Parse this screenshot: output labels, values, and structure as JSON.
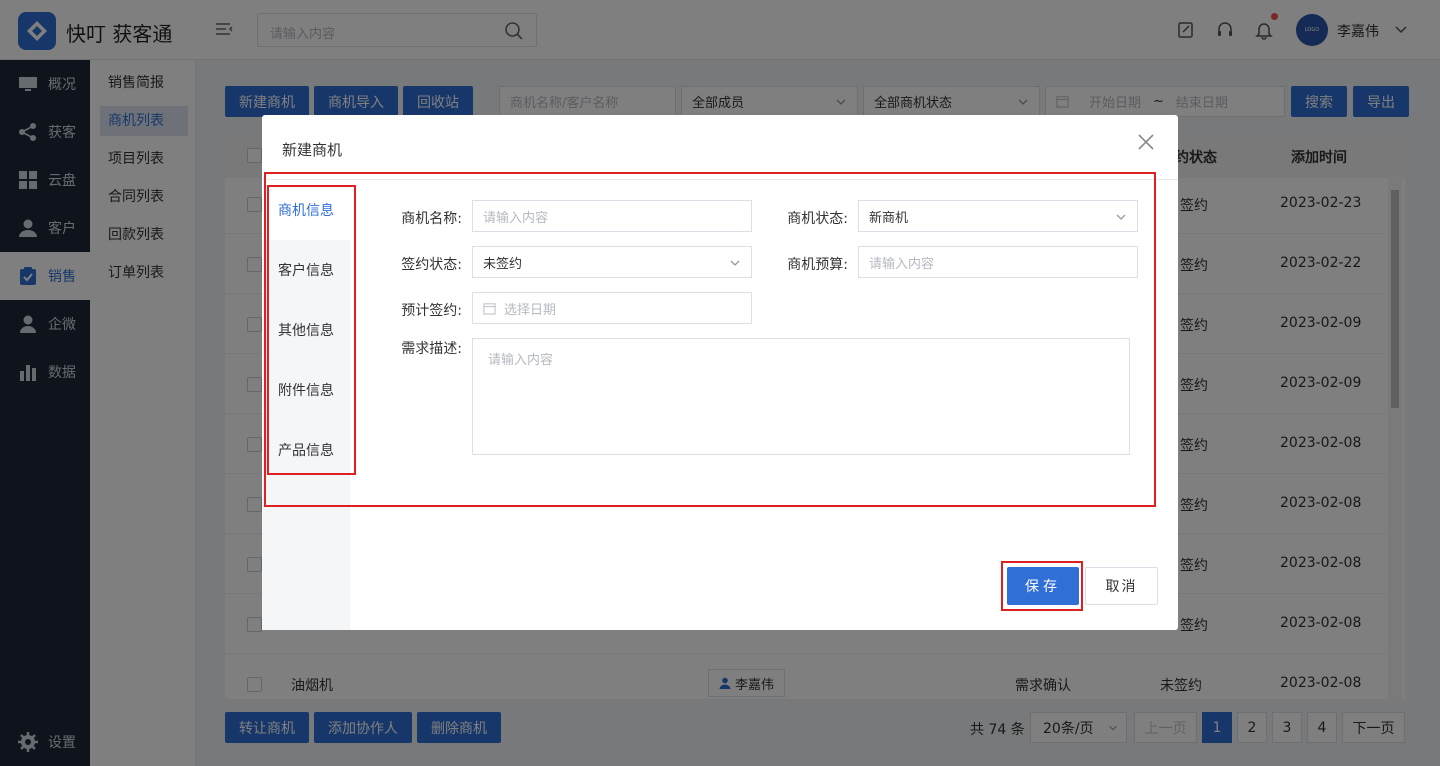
{
  "app": {
    "brand": "快叮 获客通"
  },
  "header": {
    "search_placeholder": "请输入内容",
    "username": "李嘉伟",
    "avatar_text": "LOGO"
  },
  "sidebar": {
    "items": [
      {
        "label": "概况",
        "icon": "monitor-icon"
      },
      {
        "label": "获客",
        "icon": "share-icon"
      },
      {
        "label": "云盘",
        "icon": "grid-icon"
      },
      {
        "label": "客户",
        "icon": "person-icon"
      },
      {
        "label": "销售",
        "icon": "clipboard-check-icon",
        "active": true
      },
      {
        "label": "企微",
        "icon": "user-icon"
      },
      {
        "label": "数据",
        "icon": "bar-chart-icon"
      }
    ],
    "settings": "设置"
  },
  "subnav": {
    "items": [
      {
        "label": "销售简报"
      },
      {
        "label": "商机列表",
        "active": true
      },
      {
        "label": "项目列表"
      },
      {
        "label": "合同列表"
      },
      {
        "label": "回款列表"
      },
      {
        "label": "订单列表"
      }
    ]
  },
  "toolbar": {
    "new_opportunity": "新建商机",
    "import_opportunity": "商机导入",
    "recycle_bin": "回收站",
    "search_placeholder": "商机名称/客户名称",
    "members_filter": "全部成员",
    "status_filter": "全部商机状态",
    "start_date_placeholder": "开始日期",
    "date_sep": "~",
    "end_date_placeholder": "结束日期",
    "search": "搜索",
    "export": "导出"
  },
  "table": {
    "headers": {
      "sign_status": "约状态",
      "added_time": "添加时间"
    },
    "rows": [
      {
        "sign": "签约",
        "date": "2023-02-23"
      },
      {
        "sign": "签约",
        "date": "2023-02-22"
      },
      {
        "sign": "签约",
        "date": "2023-02-09"
      },
      {
        "sign": "签约",
        "date": "2023-02-09"
      },
      {
        "sign": "签约",
        "date": "2023-02-08"
      },
      {
        "sign": "签约",
        "date": "2023-02-08"
      },
      {
        "sign": "签约",
        "date": "2023-02-08"
      },
      {
        "sign": "签约",
        "date": "2023-02-08"
      }
    ],
    "last_row": {
      "name": "油烟机",
      "owner": "李嘉伟",
      "status": "需求确认",
      "sign": "未签约",
      "date": "2023-02-08"
    }
  },
  "bottom": {
    "transfer": "转让商机",
    "add_collaborator": "添加协作人",
    "delete": "删除商机",
    "total": "共 74 条",
    "page_size": "20条/页",
    "prev": "上一页",
    "pages": [
      "1",
      "2",
      "3",
      "4"
    ],
    "next": "下一页"
  },
  "modal": {
    "title": "新建商机",
    "tabs": [
      "商机信息",
      "客户信息",
      "其他信息",
      "附件信息",
      "产品信息"
    ],
    "fields": {
      "name_label": "商机名称:",
      "name_placeholder": "请输入内容",
      "status_label": "商机状态:",
      "status_value": "新商机",
      "sign_label": "签约状态:",
      "sign_value": "未签约",
      "budget_label": "商机预算:",
      "budget_placeholder": "请输入内容",
      "expected_label": "预计签约:",
      "expected_placeholder": "选择日期",
      "desc_label": "需求描述:",
      "desc_placeholder": "请输入内容"
    },
    "save": "保存",
    "cancel": "取消"
  },
  "colors": {
    "primary": "#2f6fd6",
    "sidebar_bg": "#1f2838",
    "highlight": "#e02020"
  }
}
